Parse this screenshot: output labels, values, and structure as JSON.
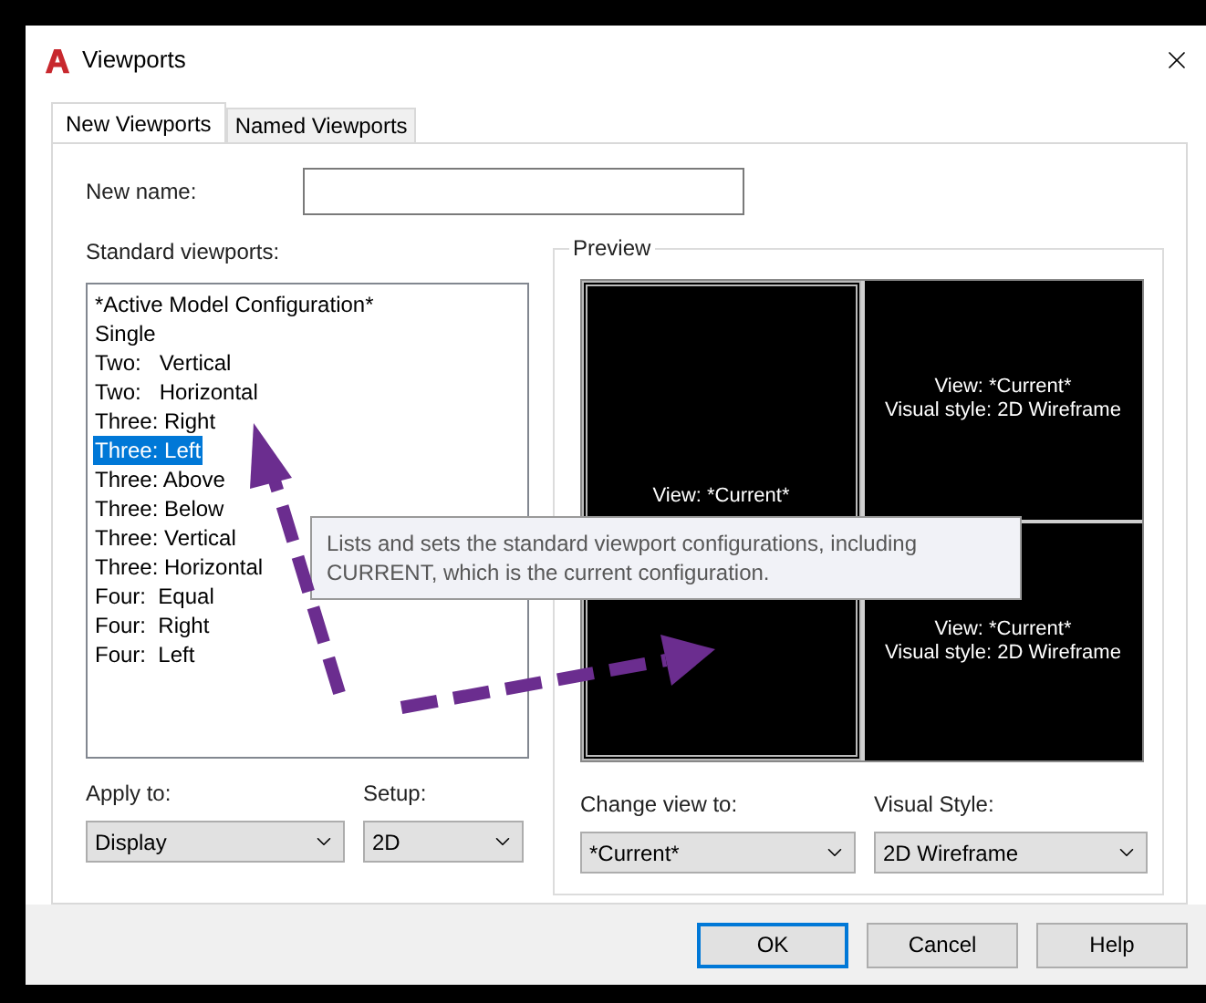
{
  "window": {
    "title": "Viewports"
  },
  "tabs": [
    {
      "label": "New Viewports",
      "selected": true
    },
    {
      "label": "Named Viewports",
      "selected": false
    }
  ],
  "new_name": {
    "label": "New name:"
  },
  "standard_viewports": {
    "label": "Standard viewports:",
    "items": [
      {
        "label": "*Active Model Configuration*",
        "selected": false
      },
      {
        "label": "Single",
        "selected": false
      },
      {
        "label": "Two:   Vertical",
        "selected": false
      },
      {
        "label": "Two:   Horizontal",
        "selected": false
      },
      {
        "label": "Three: Right",
        "selected": false
      },
      {
        "label": "Three: Left",
        "selected": true
      },
      {
        "label": "Three: Above",
        "selected": false
      },
      {
        "label": "Three: Below",
        "selected": false
      },
      {
        "label": "Three: Vertical",
        "selected": false
      },
      {
        "label": "Three: Horizontal",
        "selected": false
      },
      {
        "label": "Four:  Equal",
        "selected": false
      },
      {
        "label": "Four:  Right",
        "selected": false
      },
      {
        "label": "Four:  Left",
        "selected": false
      }
    ]
  },
  "preview": {
    "title": "Preview",
    "panes": [
      {
        "lines": [
          "View: *Current*"
        ],
        "selected": true
      },
      {
        "lines": [
          "View: *Current*",
          "Visual style: 2D Wireframe"
        ],
        "selected": false
      },
      {
        "lines": [
          "View: *Current*",
          "Visual style: 2D Wireframe"
        ],
        "selected": false
      }
    ]
  },
  "apply_to": {
    "label": "Apply to:",
    "value": "Display"
  },
  "setup": {
    "label": "Setup:",
    "value": "2D"
  },
  "change_view_to": {
    "label": "Change view to:",
    "value": "*Current*"
  },
  "visual_style": {
    "label": "Visual Style:",
    "value": "2D Wireframe"
  },
  "tooltip": {
    "lines": [
      "Lists and sets the standard viewport configurations, including",
      "CURRENT, which is the current configuration."
    ]
  },
  "buttons": [
    {
      "label": "OK",
      "default": true
    },
    {
      "label": "Cancel",
      "default": false
    },
    {
      "label": "Help",
      "default": false
    }
  ]
}
